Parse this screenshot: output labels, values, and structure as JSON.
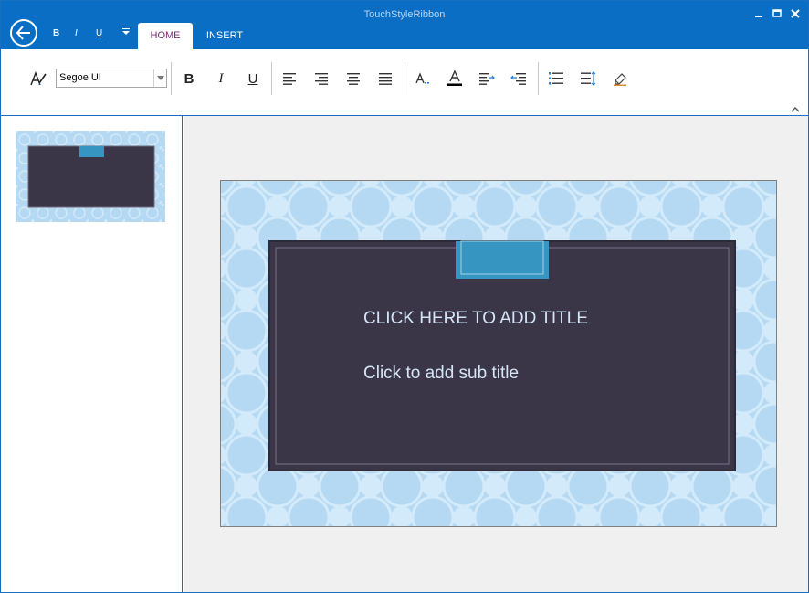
{
  "window": {
    "title": "TouchStyleRibbon"
  },
  "quick_access": {
    "bold": "B",
    "italic": "I",
    "underline": "U"
  },
  "tabs": [
    {
      "label": "HOME",
      "selected": true
    },
    {
      "label": "INSERT",
      "selected": false
    }
  ],
  "ribbon": {
    "font_name": "Segoe UI",
    "bold": "B",
    "italic": "I",
    "underline": "U"
  },
  "slide": {
    "title_placeholder": "CLICK HERE TO ADD TITLE",
    "subtitle_placeholder": "Click to add sub title"
  },
  "colors": {
    "titlebar": "#0a6fc4",
    "tab_selected_text": "#7a2a7a",
    "slide_background": "#b5d9f2",
    "slide_pattern": "#d3eafb",
    "slide_panel": "#3a3648",
    "accent_tab": "#3796c1"
  }
}
